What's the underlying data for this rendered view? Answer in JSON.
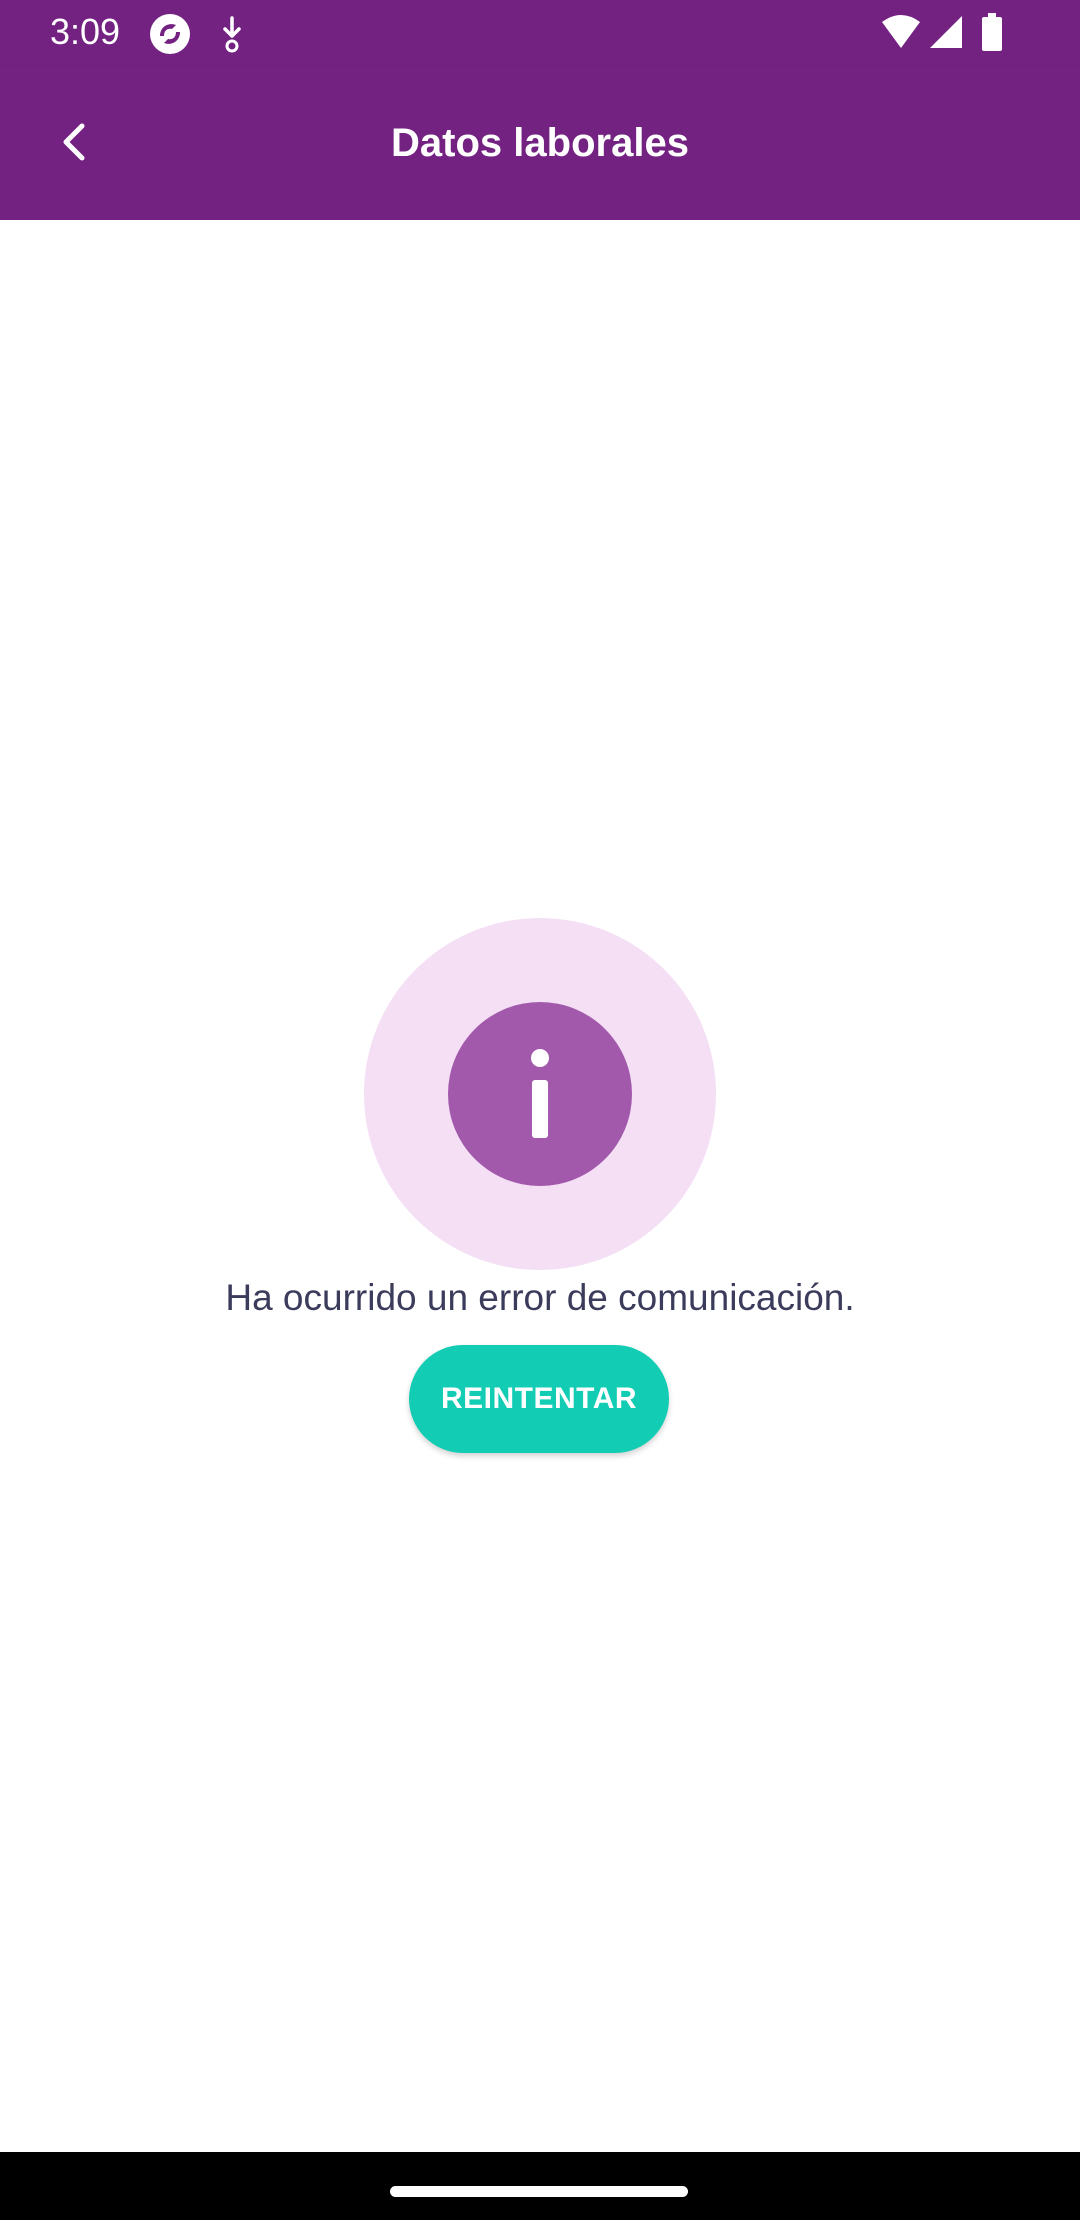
{
  "status_bar": {
    "time": "3:09",
    "icons": [
      "app-notification-icon",
      "download-notification-icon",
      "wifi-icon",
      "signal-icon",
      "battery-icon"
    ]
  },
  "app_bar": {
    "title": "Datos laborales",
    "back_icon": "chevron-left-icon",
    "background_color": "#732282"
  },
  "error_state": {
    "icon": "info-icon",
    "message": "Ha ocurrido un error de comunicación.",
    "retry_label": "REINTENTAR",
    "retry_color": "#12ccb4",
    "icon_outer_color": "#f4dff5",
    "icon_inner_color": "#a259ac"
  }
}
